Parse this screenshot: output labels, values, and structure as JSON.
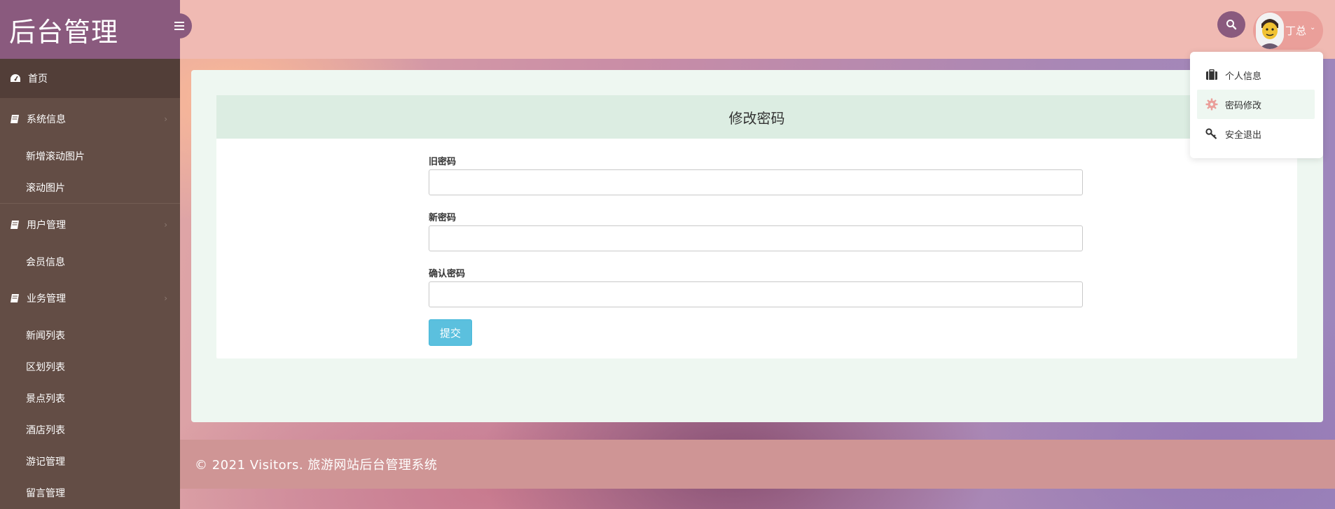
{
  "brand": {
    "title": "后台管理"
  },
  "header": {
    "user_name": "丁总",
    "caret": "⌄"
  },
  "user_menu": {
    "items": [
      {
        "label": "个人信息",
        "icon": "briefcase-icon"
      },
      {
        "label": "密码修改",
        "icon": "gear-icon"
      },
      {
        "label": "安全退出",
        "icon": "key-icon"
      }
    ]
  },
  "sidebar": {
    "home": {
      "label": "首页",
      "icon": "dashboard-icon"
    },
    "groups": [
      {
        "label": "系统信息",
        "icon": "book-icon",
        "items": [
          "新增滚动图片",
          "滚动图片"
        ]
      },
      {
        "label": "用户管理",
        "icon": "book-icon",
        "items": [
          "会员信息"
        ]
      },
      {
        "label": "业务管理",
        "icon": "book-icon",
        "items": [
          "新闻列表",
          "区划列表",
          "景点列表",
          "酒店列表",
          "游记管理",
          "留言管理"
        ]
      }
    ],
    "chevron": "›"
  },
  "form": {
    "title": "修改密码",
    "fields": [
      {
        "label": "旧密码",
        "value": ""
      },
      {
        "label": "新密码",
        "value": ""
      },
      {
        "label": "确认密码",
        "value": ""
      }
    ],
    "submit_label": "提交"
  },
  "footer": {
    "text": "© 2021 Visitors. 旅游网站后台管理系统"
  },
  "colors": {
    "brand": "#8a5a7e",
    "sidebar": "#634d45",
    "topbar": "#f0bab3",
    "submit": "#5bc0de",
    "footer": "#cf9595"
  }
}
